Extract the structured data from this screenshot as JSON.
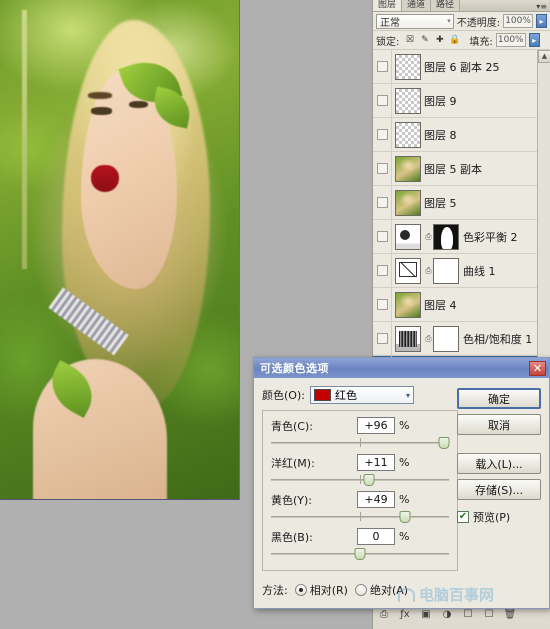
{
  "panel": {
    "tabs": [
      {
        "label": "图层",
        "active": true
      },
      {
        "label": "通道",
        "active": false
      },
      {
        "label": "路径",
        "active": false
      }
    ],
    "menu_icon": "▾≡",
    "blend_mode": "正常",
    "opacity_label": "不透明度:",
    "opacity_value": "100%",
    "lock_label": "锁定:",
    "lock_icons": [
      "透明像素锁",
      "画笔锁",
      "移动锁",
      "全部锁"
    ],
    "fill_label": "填充:",
    "fill_value": "100%",
    "arrow_glyph": "▸",
    "scroll_up_glyph": "▲",
    "layers": [
      {
        "name": "图层 6 副本 25",
        "thumb": "checker",
        "mask": false,
        "selected": false
      },
      {
        "name": "图层 9",
        "thumb": "checker",
        "mask": false,
        "selected": false
      },
      {
        "name": "图层 8",
        "thumb": "checker",
        "mask": false,
        "selected": false
      },
      {
        "name": "图层 5 副本",
        "thumb": "photo",
        "mask": false,
        "selected": false
      },
      {
        "name": "图层 5",
        "thumb": "photo",
        "mask": false,
        "selected": false
      },
      {
        "name": "色彩平衡 2",
        "thumb": "adj-cb",
        "mask": "black",
        "selected": false
      },
      {
        "name": "曲线 1",
        "thumb": "adj-curve",
        "mask": "white",
        "selected": false
      },
      {
        "name": "图层 4",
        "thumb": "photo",
        "mask": false,
        "selected": false
      },
      {
        "name": "色相/饱和度 1",
        "thumb": "adj-hue",
        "mask": "white",
        "selected": false
      },
      {
        "name": "",
        "thumb": "adj-hue",
        "mask": "white",
        "selected": true
      }
    ],
    "bottom_icons": [
      "link-icon",
      "fx-icon",
      "mask-icon",
      "adjustment-icon",
      "group-icon",
      "new-layer-icon",
      "delete-icon"
    ]
  },
  "dialog": {
    "title": "可选颜色选项",
    "close_glyph": "✕",
    "color_label": "颜色(O):",
    "color_value": "红色",
    "color_swatch_hex": "#C40000",
    "chevron_glyph": "▾",
    "sliders": [
      {
        "label": "青色(C):",
        "value": "+96",
        "unit": "%",
        "pos": 97
      },
      {
        "label": "洋红(M):",
        "value": "+11",
        "unit": "%",
        "pos": 55
      },
      {
        "label": "黄色(Y):",
        "value": "+49",
        "unit": "%",
        "pos": 75
      },
      {
        "label": "黑色(B):",
        "value": "0",
        "unit": "%",
        "pos": 50
      }
    ],
    "buttons": [
      {
        "label": "确定",
        "primary": true
      },
      {
        "label": "取消",
        "primary": false
      },
      {
        "label": "载入(L)...",
        "primary": false
      },
      {
        "label": "存储(S)...",
        "primary": false
      }
    ],
    "preview_label": "预览(P)",
    "preview_checked": true,
    "check_glyph": "✔",
    "method_label": "方法:",
    "method_options": [
      {
        "label": "相对(R)",
        "selected": true
      },
      {
        "label": "绝对(A)",
        "selected": false
      }
    ]
  },
  "watermark": {
    "text": "电脑百事网"
  }
}
